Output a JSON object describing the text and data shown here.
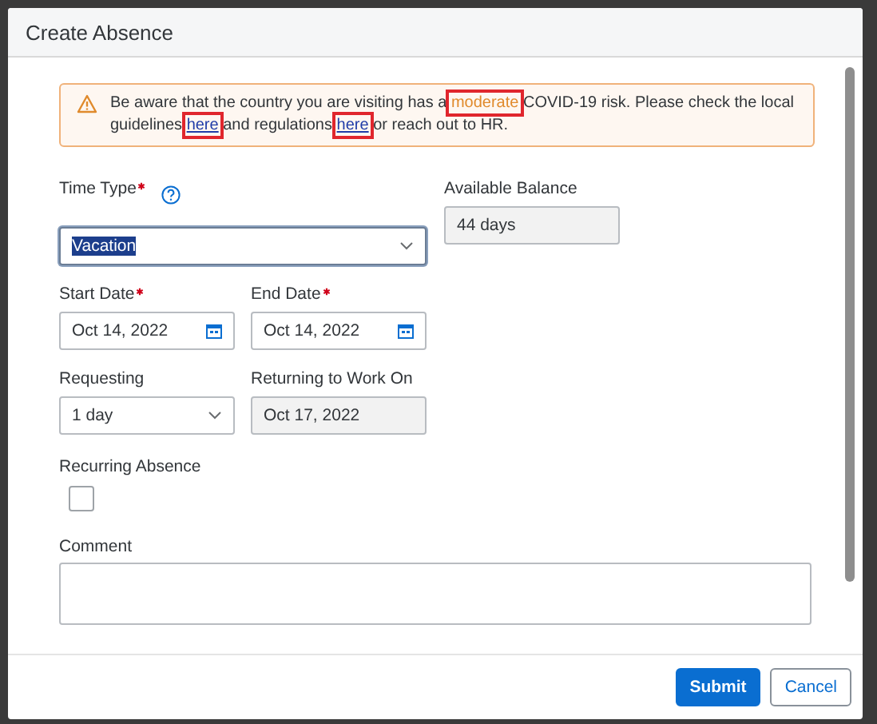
{
  "dialog": {
    "title": "Create Absence"
  },
  "banner": {
    "segments": [
      {
        "kind": "plain",
        "text": "Be aware that the country you are visiting has a ",
        "highlighted": false
      },
      {
        "kind": "risk",
        "text": "moderate",
        "highlighted": true
      },
      {
        "kind": "plain",
        "text": " COVID-19 risk. Please check the local guidelines ",
        "highlighted": false
      },
      {
        "kind": "link",
        "text": "here",
        "highlighted": true
      },
      {
        "kind": "plain",
        "text": " and regulations ",
        "highlighted": false
      },
      {
        "kind": "link",
        "text": "here",
        "highlighted": true
      },
      {
        "kind": "plain",
        "text": " or reach out to HR.",
        "highlighted": false
      }
    ]
  },
  "time_type": {
    "label": "Time Type",
    "required": true,
    "value": "Vacation",
    "focused": true
  },
  "available_balance": {
    "label": "Available Balance",
    "value": "44 days"
  },
  "start_date": {
    "label": "Start Date",
    "required": true,
    "value": "Oct 14, 2022"
  },
  "end_date": {
    "label": "End Date",
    "required": true,
    "value": "Oct 14, 2022"
  },
  "requesting": {
    "label": "Requesting",
    "value": "1 day"
  },
  "returning": {
    "label": "Returning to Work On",
    "value": "Oct 17, 2022"
  },
  "recurring": {
    "label": "Recurring Absence",
    "checked": false
  },
  "comment": {
    "label": "Comment"
  },
  "buttons": [
    {
      "label": "Submit",
      "kind": "primary"
    },
    {
      "label": "Cancel",
      "kind": "secondary"
    }
  ]
}
